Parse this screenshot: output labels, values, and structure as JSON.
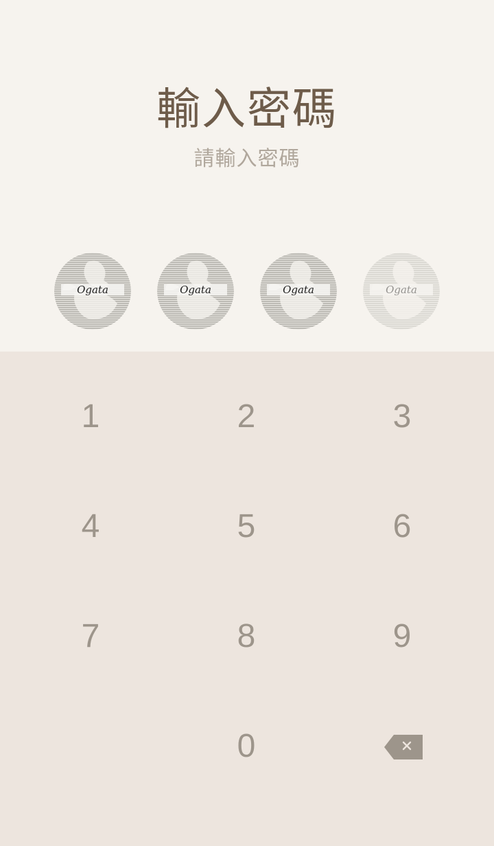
{
  "title": "輸入密碼",
  "subtitle": "請輸入密碼",
  "passcode": {
    "length": 4,
    "filled": 3,
    "dot_label": "Ogata",
    "filled_color": "#bcbab4",
    "empty_color": "#e6e2dc"
  },
  "keypad": {
    "keys": [
      "1",
      "2",
      "3",
      "4",
      "5",
      "6",
      "7",
      "8",
      "9",
      "0"
    ],
    "backspace_icon": "backspace-icon"
  },
  "colors": {
    "header_bg": "#f6f3ee",
    "keypad_bg": "#ede5de",
    "title": "#6e5c4a",
    "subtitle": "#b0a79c",
    "key_text": "#9d958b",
    "backspace": "#9d958b"
  }
}
